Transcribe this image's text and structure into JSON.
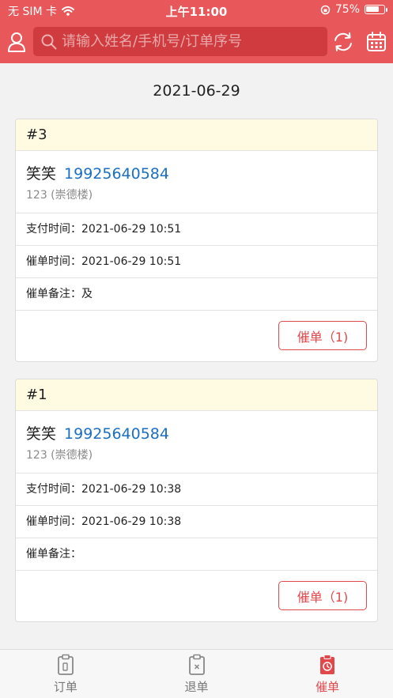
{
  "status_bar": {
    "carrier": "无 SIM 卡",
    "time": "上午11:00",
    "battery_percent": "75%",
    "battery_level": 0.75
  },
  "search": {
    "placeholder": "请输入姓名/手机号/订单序号"
  },
  "date_heading": "2021-06-29",
  "orders": [
    {
      "number": "#3",
      "name": "笑笑",
      "phone": "19925640584",
      "address": "123 (崇德楼)",
      "pay_time": "支付时间：2021-06-29 10:51",
      "urge_time": "催单时间：2021-06-29 10:51",
      "urge_note": "催单备注：及",
      "urge_button": "催单（1)"
    },
    {
      "number": "#1",
      "name": "笑笑",
      "phone": "19925640584",
      "address": "123 (崇德楼)",
      "pay_time": "支付时间：2021-06-29 10:38",
      "urge_time": "催单时间：2021-06-29 10:38",
      "urge_note": "催单备注：",
      "urge_button": "催单（1)"
    }
  ],
  "tabs": [
    {
      "label": "订单",
      "icon": "clipboard-icon",
      "active": false
    },
    {
      "label": "退单",
      "icon": "clipboard-x-icon",
      "active": false
    },
    {
      "label": "催单",
      "icon": "clock-clipboard-icon",
      "active": true
    }
  ],
  "colors": {
    "accent": "#e8575a",
    "phone_link": "#1b6fc2",
    "header_bg": "#fffbe3"
  }
}
